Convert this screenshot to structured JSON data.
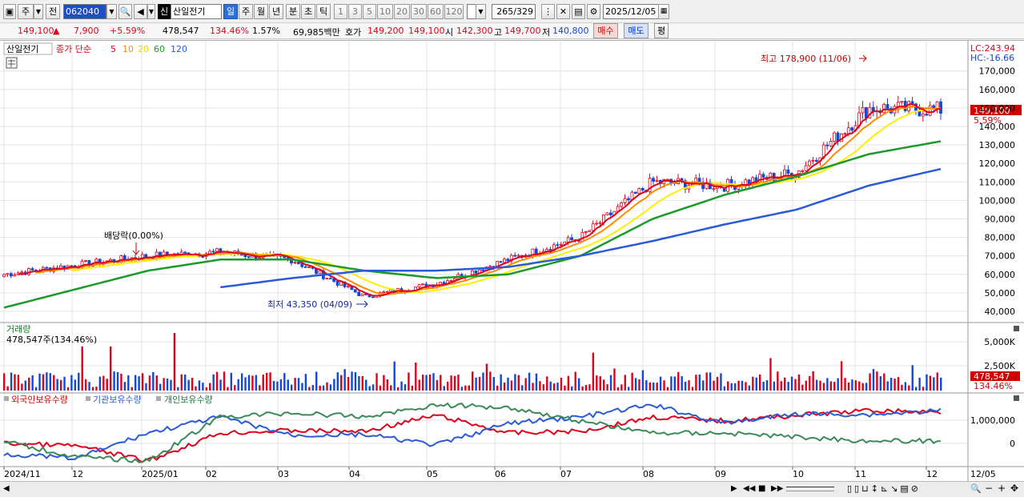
{
  "toolbar": {
    "period_label": "주",
    "prev_label": "전",
    "code": "062040",
    "new_badge": "신",
    "stock_name": "산일전기",
    "periods": [
      "일",
      "주",
      "월",
      "년",
      "분",
      "초",
      "틱"
    ],
    "active_period": "일",
    "intervals": [
      "1",
      "3",
      "5",
      "10",
      "20",
      "30",
      "60",
      "120"
    ],
    "count": "265",
    "total": "/329",
    "date": "2025/12/05"
  },
  "quote": {
    "price": "149,100",
    "change": "7,900",
    "change_pct": "+5.59%",
    "volume": "478,547",
    "volume_ratio": "134.46%",
    "turnover": "1.57%",
    "amount": "69,985백만",
    "hoga_label": "호가",
    "ask": "149,200",
    "bid": "149,100",
    "open_label": "시",
    "open": "142,300",
    "high_label": "고",
    "high": "149,700",
    "low_label": "저",
    "low": "140,800",
    "buy_label": "매수",
    "sell_label": "매도",
    "eval_label": "평"
  },
  "price_panel": {
    "name": "산일전기",
    "legend_title": "종가 단순",
    "ma": [
      {
        "label": "5",
        "color": "#e0001a"
      },
      {
        "label": "10",
        "color": "#ff8c00"
      },
      {
        "label": "20",
        "color": "#e6d800"
      },
      {
        "label": "60",
        "color": "#1a9a2a"
      },
      {
        "label": "120",
        "color": "#2a5ad8"
      }
    ],
    "lc": "LC:243.94",
    "hc": "HC:-16.66",
    "price_tag": "149,100",
    "pct_tag": "5.59%",
    "high_annotation": "최고 178,900 (11/06)",
    "low_annotation": "최저 43,350 (04/09)",
    "dividend_annotation": "배당락(0.00%)",
    "y_ticks": [
      "170,000",
      "160,000",
      "150,000",
      "140,000",
      "130,000",
      "120,000",
      "110,000",
      "100,000",
      "90,000",
      "80,000",
      "70,000",
      "60,000",
      "50,000",
      "40,000"
    ]
  },
  "volume_panel": {
    "title": "거래량",
    "value": "478,547주(134.46%)",
    "y_ticks": [
      "5,000K",
      "2,500K"
    ],
    "tag": "478,547",
    "tag_pct": "134.46%"
  },
  "holding_panel": {
    "legend": [
      "외국인보유수량",
      "기관보유수량",
      "개인보유수량"
    ],
    "y_ticks": [
      "1,000,000",
      "0"
    ]
  },
  "x_axis": {
    "labels": [
      "2024/11",
      "12",
      "2025/01",
      "02",
      "03",
      "04",
      "05",
      "06",
      "07",
      "08",
      "09",
      "10",
      "11",
      "12",
      "12/05"
    ]
  },
  "chart_data": {
    "type": "candlestick",
    "note_series": [
      "close",
      "ma5",
      "ma10",
      "ma20",
      "ma60",
      "ma120"
    ],
    "months": [
      "2024/11",
      "12",
      "2025/01",
      "02",
      "03",
      "04",
      "05",
      "06",
      "07",
      "08",
      "09",
      "10",
      "11",
      "12"
    ],
    "ylim": [
      35000,
      185000
    ],
    "close_monthly": [
      60000,
      65000,
      70000,
      72000,
      68000,
      48000,
      55000,
      68000,
      80000,
      110000,
      108000,
      115000,
      150000,
      149100
    ],
    "ma60_monthly": [
      42000,
      52000,
      62000,
      68000,
      68000,
      62000,
      58000,
      60000,
      70000,
      90000,
      103000,
      113000,
      125000,
      132000
    ],
    "ma120_monthly": [
      null,
      null,
      null,
      53000,
      58000,
      62000,
      62000,
      64000,
      70000,
      78000,
      87000,
      95000,
      108000,
      117000
    ],
    "high": 178900,
    "low": 43350
  }
}
